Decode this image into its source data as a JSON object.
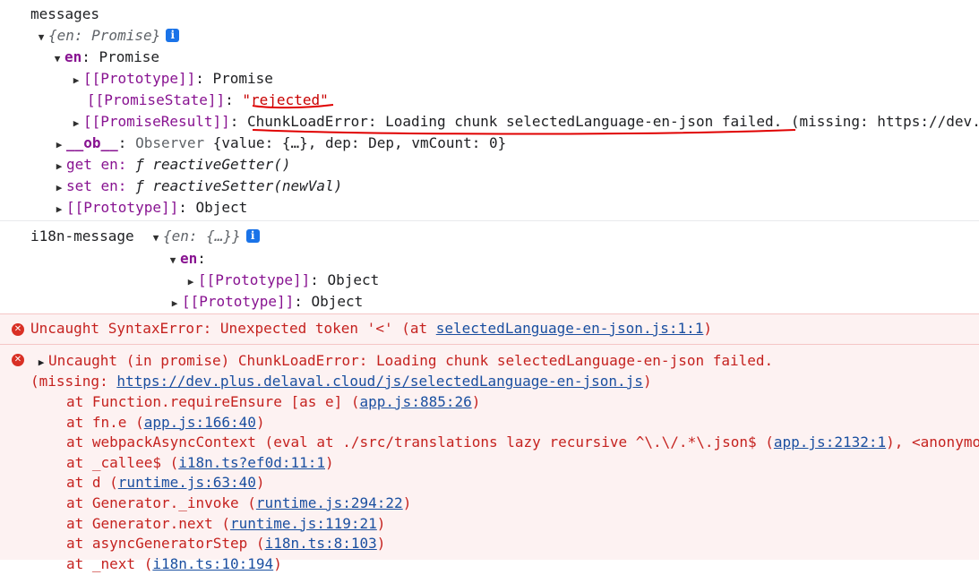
{
  "log1": {
    "label": "messages",
    "root_preview": "{en: Promise}",
    "en_key": "en",
    "en_value": "Promise",
    "proto_key": "[[Prototype]]",
    "proto_value": "Promise",
    "state_key": "[[PromiseState]]",
    "state_value": "\"rejected\"",
    "result_key": "[[PromiseResult]]",
    "result_value": "ChunkLoadError: Loading chunk selectedLanguage-en-json failed.",
    "result_more": " (missing: https://dev.plus.delaval.cloud/js/selectedLanguage-en-json.js)",
    "ob_key": "__ob__",
    "ob_type": "Observer",
    "ob_value": "{value: {…}, dep: Dep, vmCount: 0}",
    "getter_label": "get en:",
    "getter_fn": "reactiveGetter()",
    "setter_label": "set en:",
    "setter_fn": "reactiveSetter(newVal)",
    "obj_proto_key": "[[Prototype]]",
    "obj_proto_value": "Object"
  },
  "log2": {
    "label": "i18n-message",
    "root_preview": "{en: {…}}",
    "en_key": "en",
    "inner_proto_key": "[[Prototype]]",
    "inner_proto_value": "Object",
    "outer_proto_key": "[[Prototype]]",
    "outer_proto_value": "Object"
  },
  "error1": {
    "message": "Uncaught SyntaxError: Unexpected token '<' (at ",
    "link": "selectedLanguage-en-json.js:1:1",
    "suffix": ")"
  },
  "error2": {
    "message": "Uncaught (in promise) ChunkLoadError: Loading chunk selectedLanguage-en-json failed.",
    "missing_prefix": "(missing: ",
    "missing_link": "https://dev.plus.delaval.cloud/js/selectedLanguage-en-json.js",
    "missing_suffix": ")",
    "stack": [
      {
        "text": "at Function.requireEnsure [as e] (",
        "link": "app.js:885:26",
        "after": ")"
      },
      {
        "text": "at fn.e (",
        "link": "app.js:166:40",
        "after": ")"
      },
      {
        "text": "at webpackAsyncContext (eval at ./src/translations lazy recursive ^\\.\\/.*\\.json$ (",
        "link": "app.js:2132:1",
        "after": "), <anonymous>"
      },
      {
        "text": "at _callee$ (",
        "link": "i18n.ts?ef0d:11:1",
        "after": ")"
      },
      {
        "text": "at d (",
        "link": "runtime.js:63:40",
        "after": ")"
      },
      {
        "text": "at Generator._invoke (",
        "link": "runtime.js:294:22",
        "after": ")"
      },
      {
        "text": "at Generator.next (",
        "link": "runtime.js:119:21",
        "after": ")"
      },
      {
        "text": "at asyncGeneratorStep (",
        "link": "i18n.ts:8:103",
        "after": ")"
      },
      {
        "text": "at _next (",
        "link": "i18n.ts:10:194",
        "after": ")"
      }
    ]
  },
  "colors": {
    "error_text": "#c5221f",
    "error_bg": "#fdf2f2",
    "info_icon": "#1a73e8",
    "key": "#881391",
    "string": "#c80000",
    "annotation": "#e00000"
  },
  "icons": {
    "expand": "triangle-right-icon",
    "collapse": "triangle-down-icon",
    "info": "info-icon",
    "error": "error-circle-icon",
    "function": "function-f-icon"
  }
}
